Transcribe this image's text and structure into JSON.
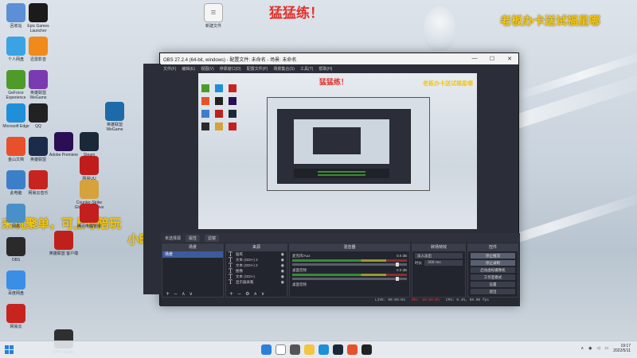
{
  "overlay": {
    "top_center_red": "猛猛练！",
    "top_right_yellow": "老板办卡送试福星哪",
    "left_yellow_line1": "来玩聚单，可上号陪玩",
    "left_yellow_line2": "小时"
  },
  "desktop_icons_col1": [
    {
      "label": "回收站",
      "icon": "recycle-bin-icon",
      "color": "#5b8fd6"
    },
    {
      "label": "个人网盘",
      "icon": "cloud-drive-icon",
      "color": "#3ba3e3"
    },
    {
      "label": "GeForce Experience",
      "icon": "nvidia-icon",
      "color": "#4e9a2a"
    },
    {
      "label": "Microsoft Edge",
      "icon": "edge-icon",
      "color": "#1f8fd8"
    },
    {
      "label": "金山文档",
      "icon": "wps-icon",
      "color": "#e8502c"
    },
    {
      "label": "此电脑",
      "icon": "computer-icon",
      "color": "#3c7fc9"
    },
    {
      "label": "网络",
      "icon": "network-icon",
      "color": "#4a90c8"
    },
    {
      "label": "OBS",
      "icon": "obs-icon",
      "color": "#2a2a2a"
    },
    {
      "label": "百度网盘",
      "icon": "baidu-netdisk-icon",
      "color": "#3a8ee6"
    },
    {
      "label": "网易云",
      "icon": "netease-icon",
      "color": "#c8241f"
    }
  ],
  "desktop_icons_col2": [
    {
      "label": "Epic Games Launcher",
      "icon": "epic-icon",
      "color": "#1b1b1b"
    },
    {
      "label": "迅雷影音",
      "icon": "player-icon",
      "color": "#f08a18"
    },
    {
      "label": "英雄联盟WeGame",
      "icon": "wegame-icon",
      "color": "#7a3bb0"
    },
    {
      "label": "QQ",
      "icon": "qq-icon",
      "color": "#222"
    },
    {
      "label": "英雄联盟",
      "icon": "lol-icon",
      "color": "#1a2c4a"
    },
    {
      "label": "网易云音乐",
      "icon": "music-icon",
      "color": "#c8241f"
    }
  ],
  "desktop_icons_col3": [
    {
      "label": "Adobe Premiere",
      "icon": "premiere-icon",
      "color": "#2b0f55"
    },
    {
      "label": "英雄联盟 客户端",
      "icon": "league-icon",
      "color": "#c0201c"
    },
    {
      "label": "OBS Studio",
      "icon": "obs-studio-icon",
      "color": "#2f2f2f"
    }
  ],
  "desktop_icons_col4": [
    {
      "label": "Steam",
      "icon": "steam-icon",
      "color": "#1b2838"
    },
    {
      "label": "网易UU",
      "icon": "uu-icon",
      "color": "#c01c1c"
    },
    {
      "label": "Counter-Strike Global Offensive",
      "icon": "csgo-icon",
      "color": "#d6a23b"
    },
    {
      "label": "腾讯电脑管家",
      "icon": "tencent-icon",
      "color": "#c41f1f"
    }
  ],
  "desktop_icons_col5": [
    {
      "label": "英雄联盟 WeGame",
      "icon": "hero-icon",
      "color": "#1e6aa8"
    }
  ],
  "desktop_file": {
    "label": "新建文件",
    "icon": "file-icon"
  },
  "obs": {
    "title": "OBS 27.2.4 (64-bit, windows) - 配置文件: 未命名 - 场景: 未命名",
    "menu": [
      "文件(F)",
      "编辑(E)",
      "视图(V)",
      "停靠窗口(D)",
      "配置文件(P)",
      "场景集合(S)",
      "工具(T)",
      "帮助(H)"
    ],
    "source_bar": {
      "label": "未选择源",
      "properties": "属性",
      "filters": "滤镜"
    },
    "scenes": {
      "header": "场景",
      "items": [
        "场景"
      ]
    },
    "sources": {
      "header": "来源",
      "items": [
        "猛练",
        "文本 (GDI+) 3",
        "文本 (GDI+) 2",
        "图像",
        "文本 (GDI+)",
        "显示器采集"
      ]
    },
    "mixer": {
      "header": "混音器",
      "channels": [
        {
          "name": "麦克风/Aux",
          "db": "0.0 dB"
        },
        {
          "name": "桌面音频",
          "db": "0.0 dB"
        }
      ],
      "channel3": "桌面音频"
    },
    "transitions": {
      "header": "转场特效",
      "type": "淡入淡出",
      "duration_label": "时长",
      "duration": "300 ms"
    },
    "controls": {
      "header": "控件",
      "buttons": [
        "停止推流",
        "停止录制",
        "启动虚拟摄像机",
        "工作室模式",
        "设置",
        "退出"
      ]
    },
    "status": {
      "live": "LIVE: 00:00:04",
      "rec": "REC: 00:00:05",
      "cpu": "CPU: 0.4%, 60.00 fps"
    },
    "preview_overlay": {
      "red": "猛猛练！",
      "yellow": "老板办卡送试福星哪"
    }
  },
  "taskbar": {
    "clock_time": "19:17",
    "clock_date": "2022/5/11"
  }
}
